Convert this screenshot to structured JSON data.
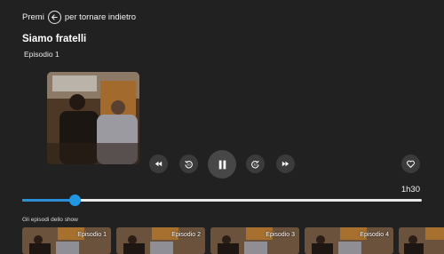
{
  "hint": {
    "prefix": "Premi",
    "suffix": "per tornare indietro"
  },
  "title": "Siamo fratelli",
  "subtitle": "Episodio 1",
  "controls": {
    "rewind": "rewind-icon",
    "back10": "replay-10-icon",
    "pause": "pause-icon",
    "forward10": "forward-10-icon",
    "fastforward": "fast-forward-icon",
    "favorite": "heart-icon"
  },
  "progress": {
    "duration": "1h30",
    "fraction": 0.13
  },
  "episodes_label": "Gli episodi dello show",
  "episodes": [
    {
      "label": "Episodio 1"
    },
    {
      "label": "Episodio 2"
    },
    {
      "label": "Episodio 3"
    },
    {
      "label": "Episodio 4"
    },
    {
      "label": ""
    }
  ],
  "colors": {
    "background": "#212121",
    "accent": "#2196e3"
  }
}
